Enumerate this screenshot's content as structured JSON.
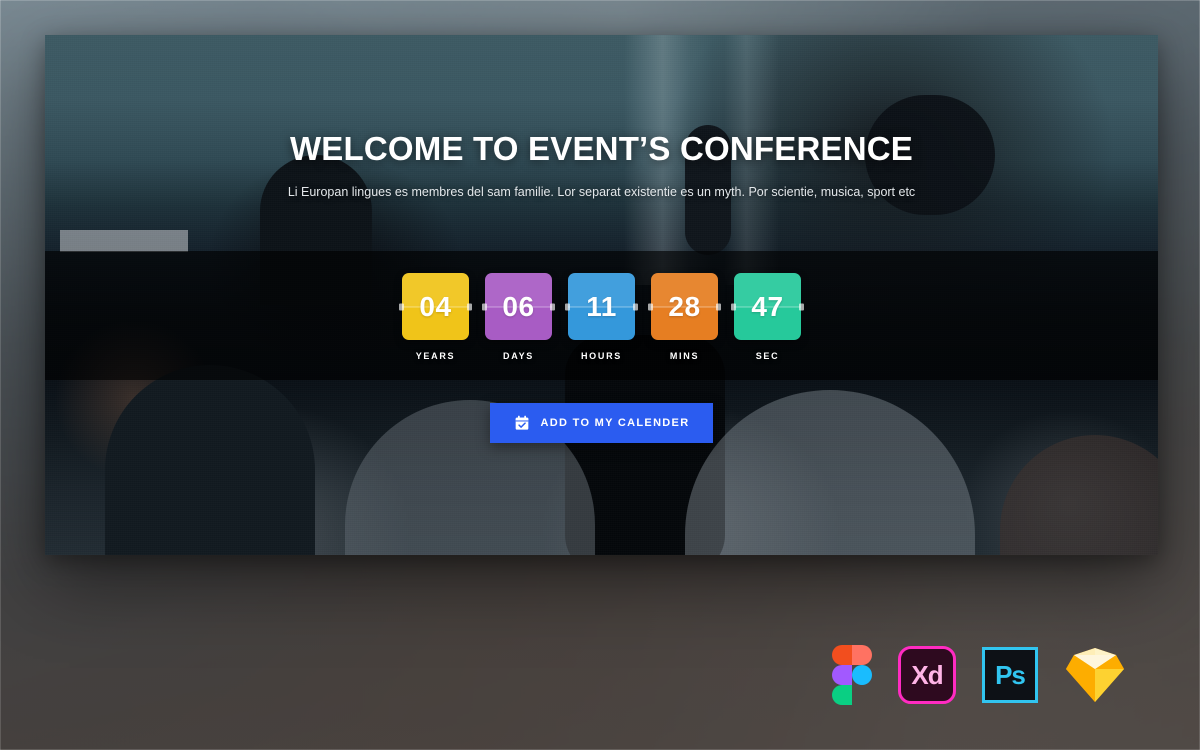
{
  "background": {
    "description": "blurred conference room backdrop"
  },
  "hero": {
    "title": "WELCOME TO EVENT’S CONFERENCE",
    "subtitle": "Li Europan lingues es membres del sam familie. Lor separat existentie es un myth. Por scientie, musica, sport etc"
  },
  "countdown": {
    "units": [
      {
        "value": "04",
        "label": "YEARS",
        "color": "#f0c419"
      },
      {
        "value": "06",
        "label": "DAYS",
        "color": "#a85cc4"
      },
      {
        "value": "11",
        "label": "HOURS",
        "color": "#3498db"
      },
      {
        "value": "28",
        "label": "MINS",
        "color": "#e67e22"
      },
      {
        "value": "47",
        "label": "SEC",
        "color": "#26c99b"
      }
    ]
  },
  "cta": {
    "label": "ADD TO MY CALENDER",
    "icon": "calendar-check-icon",
    "color": "#2b5cf0"
  },
  "apps": [
    {
      "name": "figma",
      "label": "Figma"
    },
    {
      "name": "adobe-xd",
      "label": "Xd",
      "accent": "#ff2bc2"
    },
    {
      "name": "photoshop",
      "label": "Ps",
      "accent": "#31c5f0"
    },
    {
      "name": "sketch",
      "label": "Sketch",
      "accent": "#fdad00"
    }
  ]
}
